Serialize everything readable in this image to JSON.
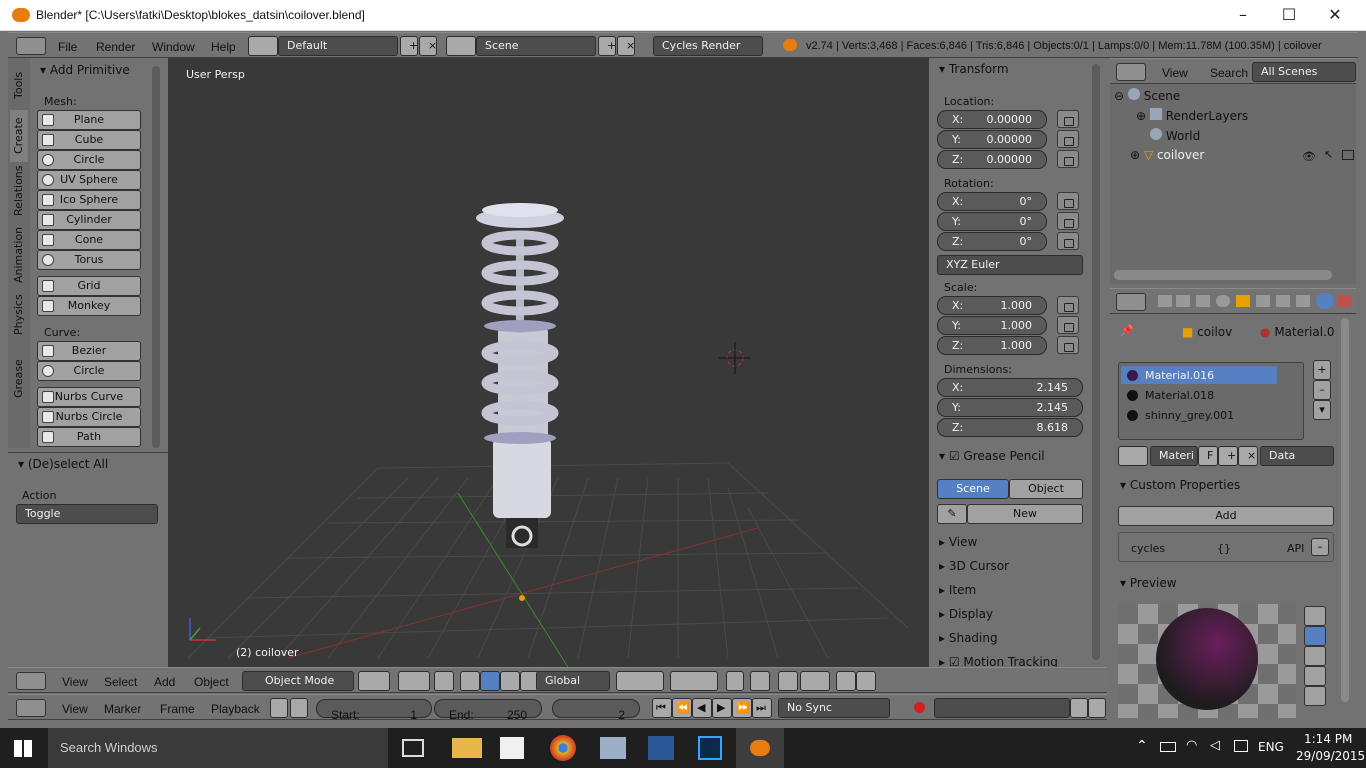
{
  "window": {
    "title": "Blender* [C:\\Users\\fatki\\Desktop\\blokes_datsin\\coilover.blend]"
  },
  "menubar": {
    "items": [
      "File",
      "Render",
      "Window",
      "Help"
    ],
    "layout": "Default",
    "scene": "Scene",
    "engine": "Cycles Render",
    "stats": "v2.74 | Verts:3,468 | Faces:6,846 | Tris:6,846 | Objects:0/1 | Lamps:0/0 | Mem:11.78M (100.35M) | coilover"
  },
  "toolshelf": {
    "tabs": [
      "Tools",
      "Create",
      "Relations",
      "Animation",
      "Physics",
      "Grease Pencil"
    ],
    "panel_title": "Add Primitive",
    "mesh_label": "Mesh:",
    "mesh": [
      "Plane",
      "Cube",
      "Circle",
      "UV Sphere",
      "Ico Sphere",
      "Cylinder",
      "Cone",
      "Torus",
      "Grid",
      "Monkey"
    ],
    "curve_label": "Curve:",
    "curve": [
      "Bezier",
      "Circle",
      "Nurbs Curve",
      "Nurbs Circle",
      "Path"
    ],
    "op_title": "(De)select All",
    "action_label": "Action",
    "action_value": "Toggle"
  },
  "viewport": {
    "view_name": "User Persp",
    "object_name": "(2) coilover"
  },
  "properties_n": {
    "transform_title": "Transform",
    "location_label": "Location:",
    "location": [
      {
        "k": "X:",
        "v": "0.00000"
      },
      {
        "k": "Y:",
        "v": "0.00000"
      },
      {
        "k": "Z:",
        "v": "0.00000"
      }
    ],
    "rotation_label": "Rotation:",
    "rotation": [
      {
        "k": "X:",
        "v": "0°"
      },
      {
        "k": "Y:",
        "v": "0°"
      },
      {
        "k": "Z:",
        "v": "0°"
      }
    ],
    "rotation_mode": "XYZ Euler",
    "scale_label": "Scale:",
    "scale": [
      {
        "k": "X:",
        "v": "1.000"
      },
      {
        "k": "Y:",
        "v": "1.000"
      },
      {
        "k": "Z:",
        "v": "1.000"
      }
    ],
    "dimensions_label": "Dimensions:",
    "dimensions": [
      {
        "k": "X:",
        "v": "2.145"
      },
      {
        "k": "Y:",
        "v": "2.145"
      },
      {
        "k": "Z:",
        "v": "8.618"
      }
    ],
    "grease_title": "Grease Pencil",
    "grease_scene": "Scene",
    "grease_object": "Object",
    "grease_new": "New",
    "collapsed": [
      "View",
      "3D Cursor",
      "Item",
      "Display",
      "Shading",
      "Motion Tracking"
    ]
  },
  "outliner": {
    "menus": [
      "View",
      "Search"
    ],
    "filter": "All Scenes",
    "rows": [
      "Scene",
      "RenderLayers",
      "World",
      "coilover"
    ]
  },
  "props": {
    "breadcrumb": [
      "coilov",
      "Material.0"
    ],
    "materials": [
      "Material.016",
      "Material.018",
      "shinny_grey.001"
    ],
    "mat_name": "Materi",
    "mat_f": "F",
    "link": "Data",
    "custom_title": "Custom Properties",
    "add": "Add",
    "prop_name": "cycles",
    "prop_value": "{}",
    "prop_api": "API",
    "preview_title": "Preview"
  },
  "view3d_header": {
    "menus": [
      "View",
      "Select",
      "Add",
      "Object"
    ],
    "mode": "Object Mode",
    "orientation": "Global"
  },
  "timeline": {
    "menus": [
      "View",
      "Marker",
      "Frame",
      "Playback"
    ],
    "start_label": "Start:",
    "start": "1",
    "end_label": "End:",
    "end": "250",
    "current": "2",
    "sync": "No Sync"
  },
  "taskbar": {
    "search": "Search Windows",
    "time": "1:14 PM",
    "date": "29/09/2015",
    "lang": "ENG"
  }
}
